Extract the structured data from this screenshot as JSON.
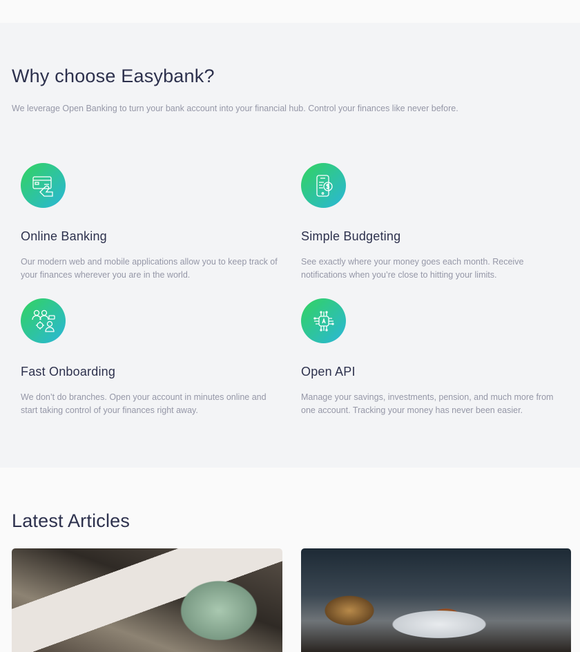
{
  "why": {
    "title": "Why choose Easybank?",
    "intro": "We leverage Open Banking to turn your bank account into your financial hub. Control your finances like never before.",
    "features": [
      {
        "icon": "online-banking-icon",
        "title": "Online Banking",
        "text": "Our modern web and mobile applications allow you to keep track of your finances wherever you are in the world."
      },
      {
        "icon": "budgeting-icon",
        "title": "Simple Budgeting",
        "text": "See exactly where your money goes each month. Receive notifications when you’re close to hitting your limits."
      },
      {
        "icon": "onboarding-icon",
        "title": "Fast Onboarding",
        "text": "We don’t do branches. Open your account in minutes online and start taking control of your finances right away."
      },
      {
        "icon": "api-icon",
        "title": "Open API",
        "text": "Manage your savings, investments, pension, and much more from one account. Tracking your money has never been easier."
      }
    ]
  },
  "articles": {
    "title": "Latest Articles",
    "images": [
      "money-photo",
      "restaurant-photo"
    ]
  },
  "colors": {
    "text_dark": "#2d314d",
    "text_muted": "#9597a7",
    "section_bg": "#f3f4f6",
    "page_bg": "#fafafa",
    "gradient_start": "#33d35e",
    "gradient_end": "#2ab6d9"
  }
}
